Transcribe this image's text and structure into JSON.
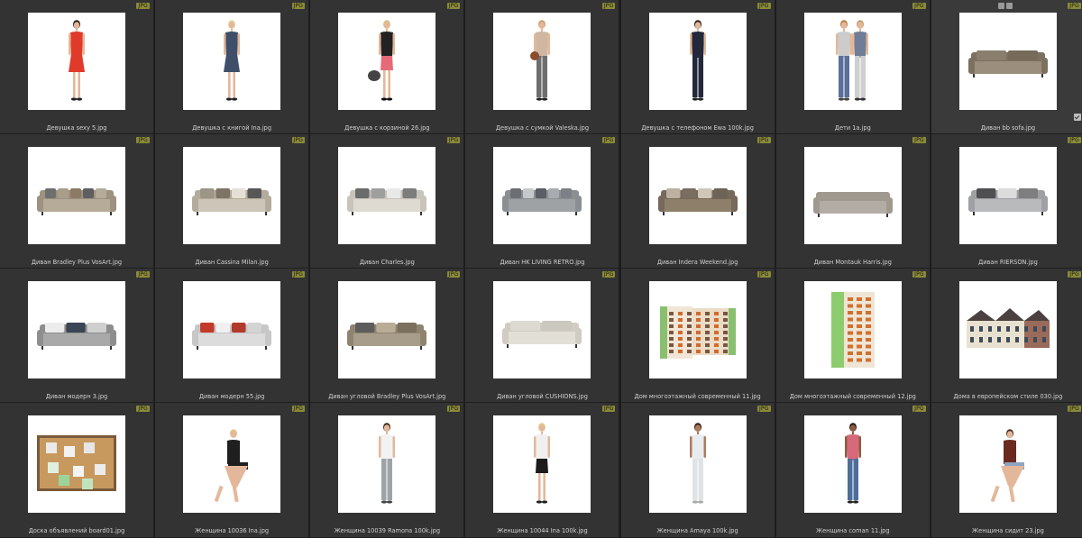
{
  "file_type_badge": "JPG",
  "items": [
    {
      "name": "Девушка sexy 5.jpg",
      "kind": "woman-red-dress"
    },
    {
      "name": "Девушка с книгой Ina.jpg",
      "kind": "woman-book"
    },
    {
      "name": "Девушка с корзиной 26.jpg",
      "kind": "woman-basket"
    },
    {
      "name": "Девушка с сумкой Valeska.jpg",
      "kind": "woman-bag"
    },
    {
      "name": "Девушка с телефоном Ewa 100k.jpg",
      "kind": "woman-phone"
    },
    {
      "name": "Дети 1a.jpg",
      "kind": "kids"
    },
    {
      "name": "Диван bb sofa.jpg",
      "kind": "sofa-low"
    },
    {
      "name": "Диван Bradley Plus VosArt.jpg",
      "kind": "sofa-beige"
    },
    {
      "name": "Диван Cassina Milan.jpg",
      "kind": "sofa-light"
    },
    {
      "name": "Диван Charles.jpg",
      "kind": "sofa-cream"
    },
    {
      "name": "Диван HK LIVING RETRO.jpg",
      "kind": "sofa-grey"
    },
    {
      "name": "Диван Indera Weekend.jpg",
      "kind": "sofa-brown"
    },
    {
      "name": "Диван Montauk Harris.jpg",
      "kind": "sofa-tufted"
    },
    {
      "name": "Диван RIERSON.jpg",
      "kind": "sofa-round"
    },
    {
      "name": "Диван модерн 3.jpg",
      "kind": "sofa-modern-grey"
    },
    {
      "name": "Диван модерн 55.jpg",
      "kind": "sofa-modern-white"
    },
    {
      "name": "Диван угловой Bradley Plus VosArt.jpg",
      "kind": "sofa-corner"
    },
    {
      "name": "Диван угловой CUSHIONS.jpg",
      "kind": "sofa-cushions"
    },
    {
      "name": "Дом многоэтажный современный 11.jpg",
      "kind": "building-l"
    },
    {
      "name": "Дом многоэтажный современный 12.jpg",
      "kind": "building-tower"
    },
    {
      "name": "Дома в европейском стиле 030.jpg",
      "kind": "houses"
    },
    {
      "name": "Доска объявлений board01.jpg",
      "kind": "board"
    },
    {
      "name": "Женщина 10036 Ina.jpg",
      "kind": "woman-sitting"
    },
    {
      "name": "Женщина 10039 Ramona 100k.jpg",
      "kind": "woman-standing"
    },
    {
      "name": "Женщина 10044 Ina 100k.jpg",
      "kind": "woman-skirt"
    },
    {
      "name": "Женщина Amaya 100k.jpg",
      "kind": "woman-white"
    },
    {
      "name": "Женщина coman 11.jpg",
      "kind": "woman-jeans"
    },
    {
      "name": "Женщина сидит 23.jpg",
      "kind": "woman-sits-2"
    }
  ],
  "selected_index": 6,
  "colors": {
    "background": "#2b2b2b",
    "cell": "#333333",
    "badge": "#8a8a3a",
    "caption": "#d0d0d0"
  }
}
